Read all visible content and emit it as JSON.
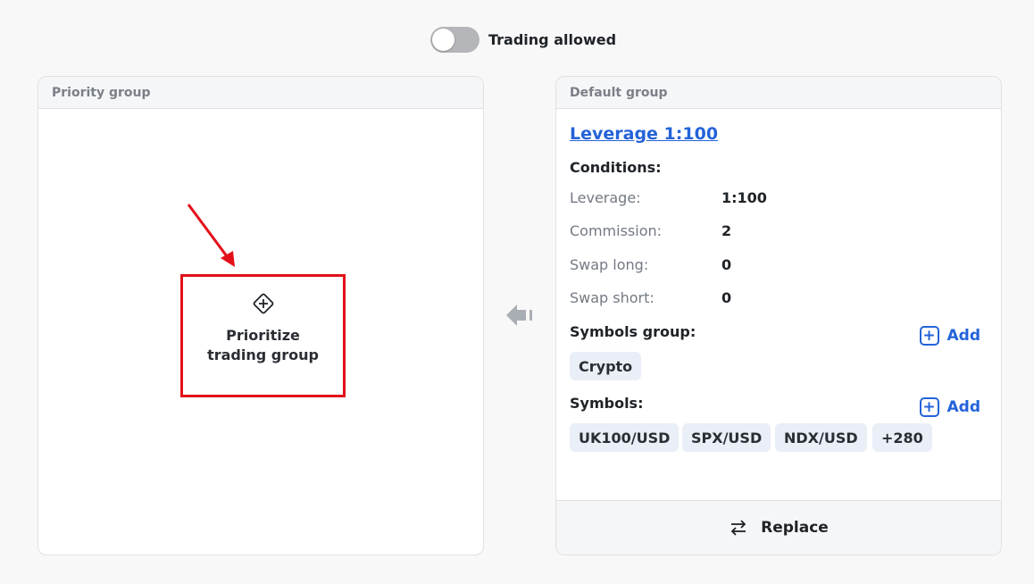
{
  "toggle": {
    "label": "Trading allowed",
    "on": false
  },
  "priority_group": {
    "header": "Priority group",
    "prioritize_label": "Prioritize trading group"
  },
  "default_group": {
    "header": "Default group",
    "leverage_link": "Leverage 1:100",
    "conditions_title": "Conditions:",
    "conditions": [
      {
        "label": "Leverage:",
        "value": "1:100"
      },
      {
        "label": "Commission:",
        "value": "2"
      },
      {
        "label": "Swap long:",
        "value": "0"
      },
      {
        "label": "Swap short:",
        "value": "0"
      }
    ],
    "symbols_group_title": "Symbols group:",
    "symbols_group_chips": [
      "Crypto"
    ],
    "symbols_title": "Symbols:",
    "symbols_chips": [
      "UK100/USD",
      "SPX/USD",
      "NDX/USD",
      "+280"
    ],
    "add_label": "Add",
    "replace_label": "Replace"
  },
  "icons": {
    "prioritize": "diamond-plus-icon",
    "add": "plus-square-icon",
    "replace": "swap-arrows-icon",
    "move": "arrow-left-icon",
    "annotation": "red-arrow-icon"
  },
  "colors": {
    "accent": "#2463d9",
    "highlight_border": "#e3101a",
    "chip_bg": "#e9eef7",
    "toggle_off": "#b4b6ba"
  }
}
